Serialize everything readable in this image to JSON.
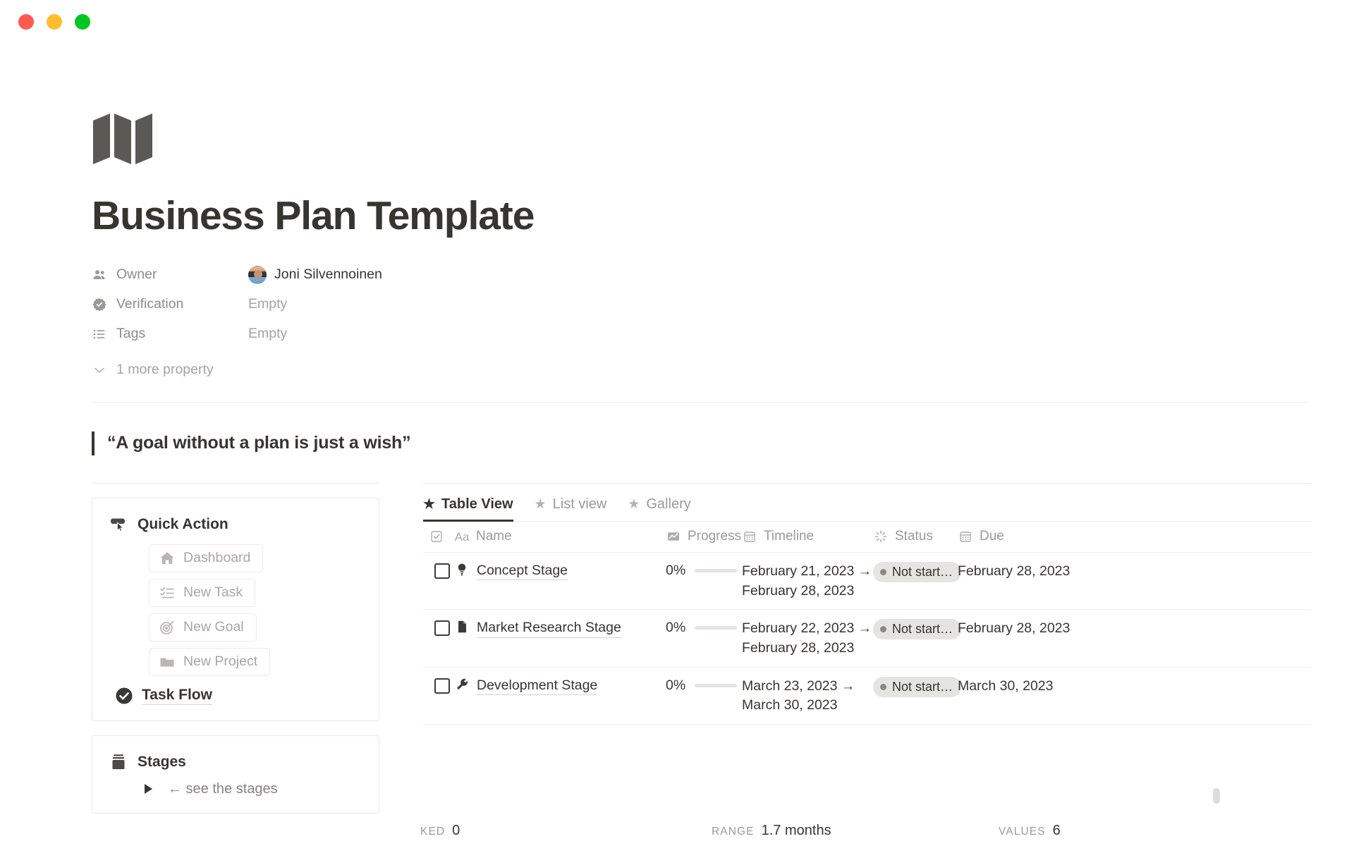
{
  "window": {
    "traffic_lights": [
      {
        "name": "close",
        "color": "#ff5a52"
      },
      {
        "name": "minimize",
        "color": "#ffbd2e"
      },
      {
        "name": "maximize",
        "color": "#00c721"
      }
    ]
  },
  "page": {
    "icon": "folded-map-icon",
    "title": "Business Plan Template"
  },
  "properties": [
    {
      "icon": "people-icon",
      "label": "Owner",
      "value": "Joni Silvennoinen",
      "type": "person",
      "empty": false
    },
    {
      "icon": "verified-badge-icon",
      "label": "Verification",
      "value": "Empty",
      "type": "text",
      "empty": true
    },
    {
      "icon": "list-icon",
      "label": "Tags",
      "value": "Empty",
      "type": "text",
      "empty": true
    }
  ],
  "more_properties": {
    "icon": "chevron-down-icon",
    "label": "1 more property"
  },
  "quote": {
    "text": "“A goal without a plan is just a wish”"
  },
  "quick_action": {
    "icon": "click-cursor-icon",
    "title": "Quick Action",
    "buttons": [
      {
        "icon": "home-icon",
        "label": "Dashboard"
      },
      {
        "icon": "task-list-icon",
        "label": "New Task"
      },
      {
        "icon": "target-icon",
        "label": "New Goal"
      },
      {
        "icon": "folder-icon",
        "label": "New Project"
      }
    ],
    "link": {
      "icon": "check-circle-icon",
      "label": "Task Flow"
    }
  },
  "stages": {
    "icon": "archive-box-icon",
    "title": "Stages",
    "toggle": {
      "icon": "triangle-right-icon",
      "label": "← see the stages"
    }
  },
  "database": {
    "tabs": [
      {
        "icon": "star-icon",
        "label": "Table View",
        "active": true
      },
      {
        "icon": "star-icon",
        "label": "List view",
        "active": false
      },
      {
        "icon": "star-icon",
        "label": "Gallery",
        "active": false
      }
    ],
    "columns": [
      {
        "key": "check",
        "icon": "checkbox-header-icon",
        "label": ""
      },
      {
        "key": "name",
        "icon": "aa-text-icon",
        "label": "Name"
      },
      {
        "key": "progress",
        "icon": "chart-icon",
        "label": "Progress"
      },
      {
        "key": "timeline",
        "icon": "calendar-icon",
        "label": "Timeline"
      },
      {
        "key": "status",
        "icon": "spinner-icon",
        "label": "Status"
      },
      {
        "key": "due",
        "icon": "calendar-icon",
        "label": "Due"
      }
    ],
    "rows": [
      {
        "checked": false,
        "icon": "lightbulb-icon",
        "name": "Concept Stage",
        "progress_pct": "0%",
        "progress_value": 0,
        "timeline": "February 21, 2023 → February 28, 2023",
        "status": "Not start…",
        "status_color": "#8a8885",
        "due": "February 28, 2023"
      },
      {
        "checked": false,
        "icon": "document-icon",
        "name": "Market Research Stage",
        "progress_pct": "0%",
        "progress_value": 0,
        "timeline": "February 22, 2023 → February 28, 2023",
        "status": "Not start…",
        "status_color": "#8a8885",
        "due": "February 28, 2023"
      },
      {
        "checked": false,
        "icon": "wrench-icon",
        "name": "Development Stage",
        "progress_pct": "0%",
        "progress_value": 0,
        "timeline": "March 23, 2023 → March 30, 2023",
        "status": "Not start…",
        "status_color": "#8a8885",
        "due": "March 30, 2023"
      }
    ],
    "footer": {
      "checked_label": "KED",
      "checked_value": "0",
      "range_label": "RANGE",
      "range_value": "1.7 months",
      "values_label": "VALUES",
      "values_value": "6"
    }
  },
  "colors": {
    "text": "#37352f",
    "muted": "#9b9a97",
    "border": "#e9e8e6",
    "pill_bg": "#e5e4e1"
  }
}
